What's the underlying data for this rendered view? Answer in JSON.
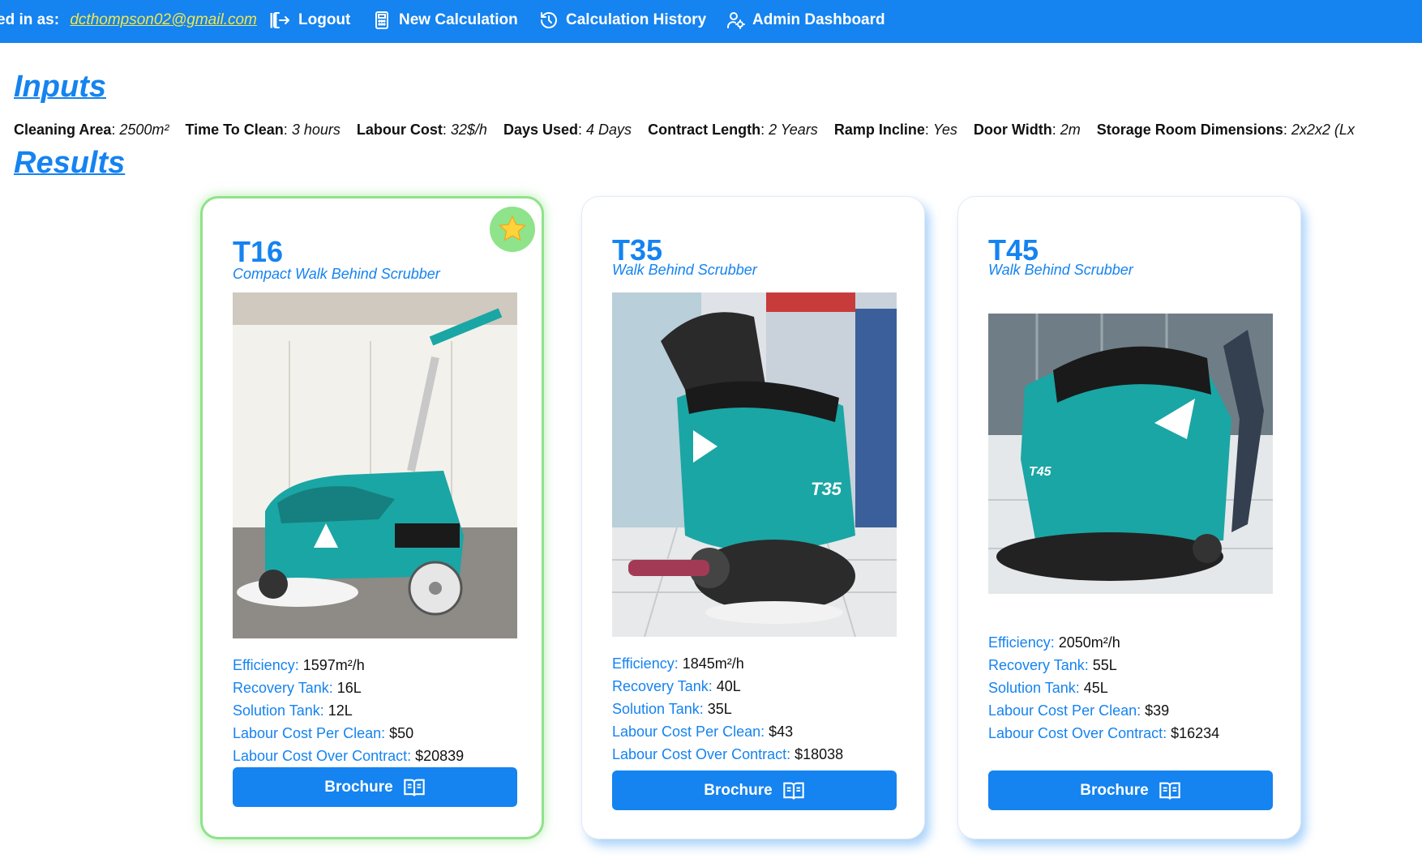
{
  "nav": {
    "logged_in_label": "ed in as:",
    "email": "dcthompson02@gmail.com",
    "separator": "||",
    "logout": "Logout",
    "new_calculation": "New Calculation",
    "calculation_history": "Calculation History",
    "admin_dashboard": "Admin Dashboard",
    "bar_color": "#1583f0"
  },
  "inputs": {
    "heading": "Inputs",
    "fields": [
      {
        "key": "Cleaning Area",
        "value": "2500m²"
      },
      {
        "key": "Time To Clean",
        "value": "3 hours"
      },
      {
        "key": "Labour Cost",
        "value": "32$/h"
      },
      {
        "key": "Days Used",
        "value": "4 Days"
      },
      {
        "key": "Contract Length",
        "value": "2 Years"
      },
      {
        "key": "Ramp Incline",
        "value": "Yes"
      },
      {
        "key": "Door Width",
        "value": "2m"
      },
      {
        "key": "Storage Room Dimensions",
        "value": "2x2x2 (Lx"
      }
    ]
  },
  "results": {
    "heading": "Results",
    "spec_labels": {
      "efficiency": "Efficiency:",
      "recovery": "Recovery Tank:",
      "solution": "Solution Tank:",
      "per_clean": "Labour Cost Per Clean:",
      "contract": "Labour Cost Over Contract:"
    },
    "brochure_label": "Brochure",
    "cards": [
      {
        "model": "T16",
        "subtitle": "Compact Walk Behind Scrubber",
        "recommended": true,
        "badge_icon": "star-icon",
        "efficiency": "1597m²/h",
        "recovery_tank": "16L",
        "solution_tank": "12L",
        "labour_cost_per_clean": "$50",
        "labour_cost_over_contract": "$20839"
      },
      {
        "model": "T35",
        "subtitle": "Walk Behind Scrubber",
        "recommended": false,
        "efficiency": "1845m²/h",
        "recovery_tank": "40L",
        "solution_tank": "35L",
        "labour_cost_per_clean": "$43",
        "labour_cost_over_contract": "$18038"
      },
      {
        "model": "T45",
        "subtitle": "Walk Behind Scrubber",
        "recommended": false,
        "efficiency": "2050m²/h",
        "recovery_tank": "55L",
        "solution_tank": "45L",
        "labour_cost_per_clean": "$39",
        "labour_cost_over_contract": "$16234"
      }
    ]
  },
  "colors": {
    "accent": "#1583f0",
    "recommended_border": "#8fe38a",
    "email": "#f1e74a",
    "machine_teal": "#1aa6a4"
  }
}
